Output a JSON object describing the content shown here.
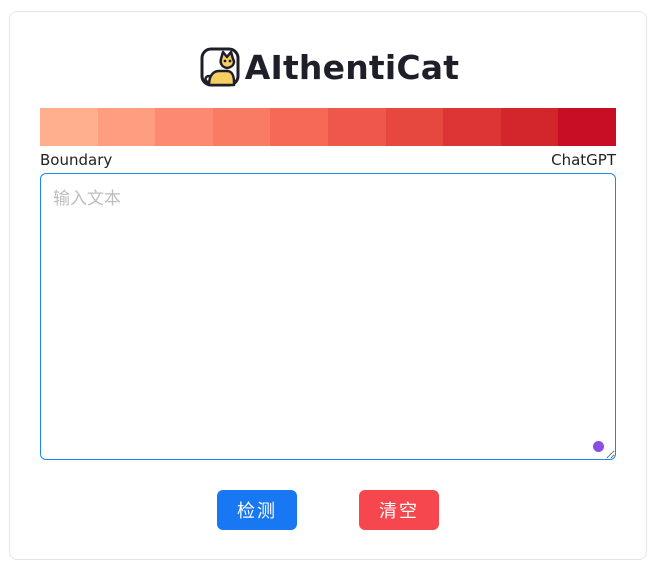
{
  "header": {
    "title": "AIthentiCat",
    "logo_icon": "cat-icon"
  },
  "scale": {
    "colors": [
      "#ffae8e",
      "#ff9d80",
      "#fd8a70",
      "#fa7b63",
      "#f56956",
      "#ed584a",
      "#e6473f",
      "#dd3535",
      "#d3262c",
      "#c70e24"
    ],
    "left_label": "Boundary",
    "right_label": "ChatGPT"
  },
  "input": {
    "placeholder": "输入文本",
    "value": ""
  },
  "buttons": {
    "detect_label": "检测",
    "clear_label": "清空",
    "detect_color": "#1877f2",
    "clear_color": "#f5474d"
  }
}
